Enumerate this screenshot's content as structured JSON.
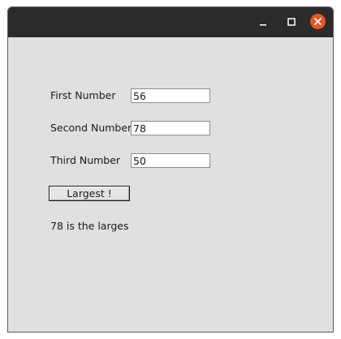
{
  "window": {
    "controls": {
      "minimize_icon": "minimize-icon",
      "maximize_icon": "maximize-icon",
      "close_icon": "close-icon",
      "close_color": "#e95420"
    }
  },
  "form": {
    "first": {
      "label": "First Number",
      "value": "56"
    },
    "second": {
      "label": "Second Number",
      "value": "78"
    },
    "third": {
      "label": "Third Number",
      "value": "50"
    },
    "button_label": "Largest !",
    "result": "78 is the larges"
  }
}
